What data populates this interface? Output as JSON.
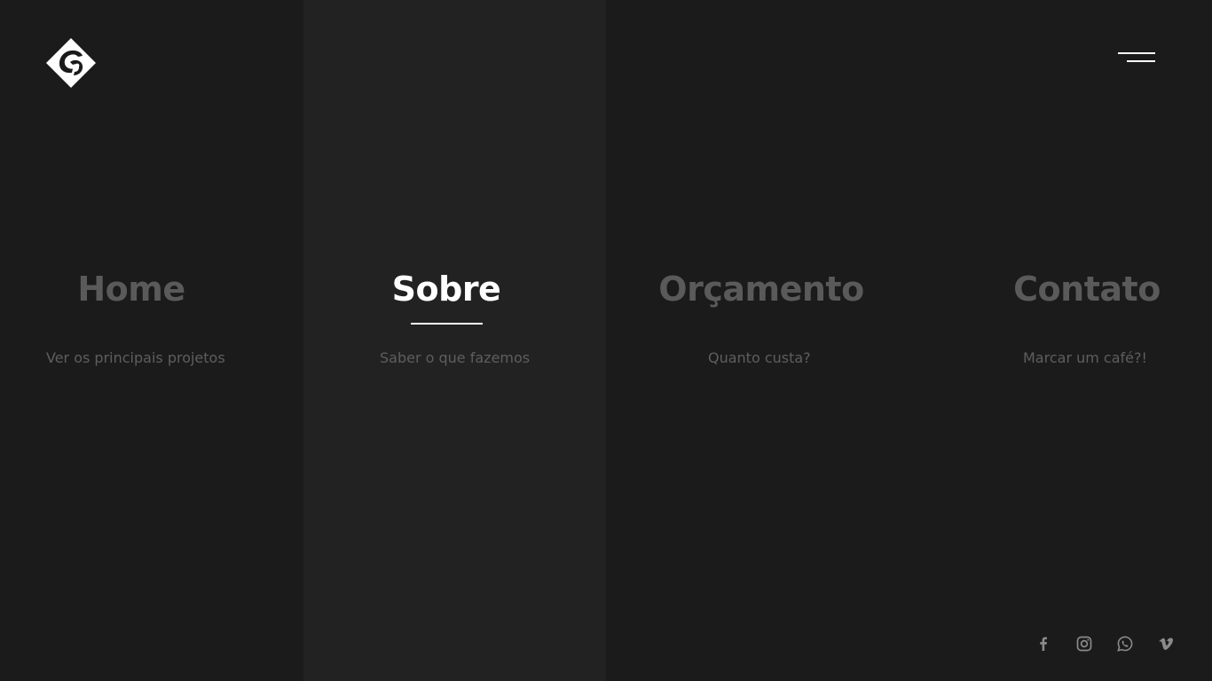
{
  "logo": {
    "icon": "logo-icon"
  },
  "menu": {
    "icon": "hamburger-menu-icon"
  },
  "nav": {
    "items": [
      {
        "label": "Home",
        "description": "Ver os principais projetos",
        "active": false
      },
      {
        "label": "Sobre",
        "description": "Saber o que fazemos",
        "active": true
      },
      {
        "label": "Orçamento",
        "description": "Quanto custa?",
        "active": false
      },
      {
        "label": "Contato",
        "description": "Marcar um café?!",
        "active": false
      }
    ]
  },
  "social": {
    "items": [
      {
        "icon": "facebook-icon"
      },
      {
        "icon": "instagram-icon"
      },
      {
        "icon": "whatsapp-icon"
      },
      {
        "icon": "vimeo-icon"
      }
    ]
  },
  "colors": {
    "background": "#1b1b1b",
    "active_column": "#222222",
    "active_text": "#ffffff",
    "inactive_text": "#5a5a5a"
  }
}
